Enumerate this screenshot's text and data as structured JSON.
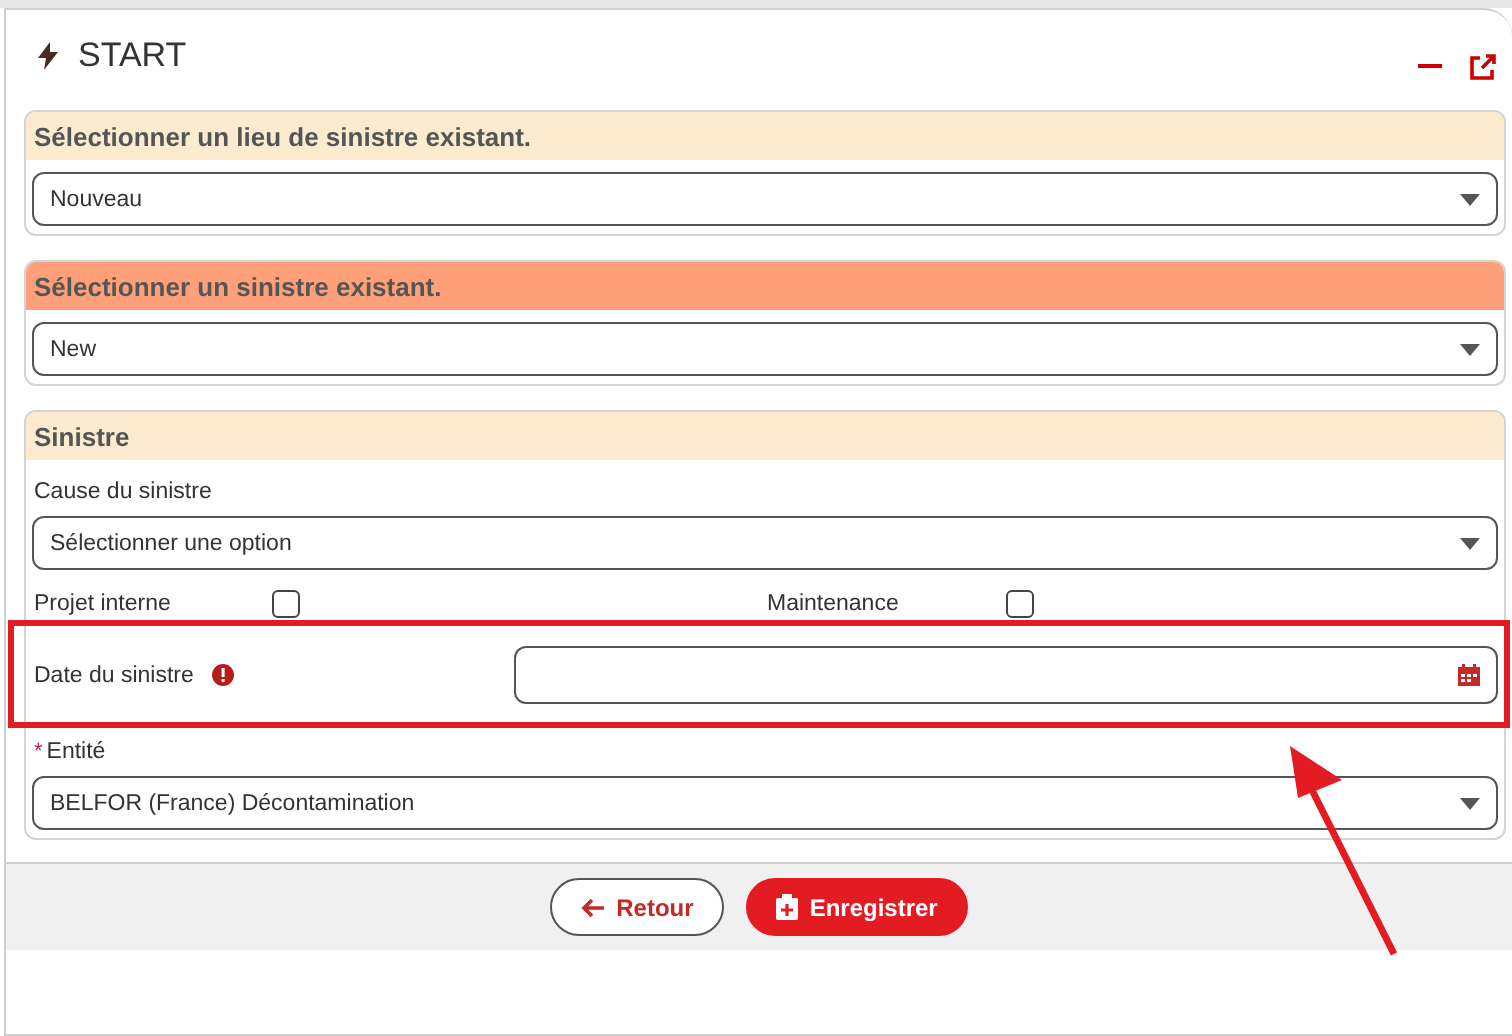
{
  "window": {
    "title": "START"
  },
  "sections": [
    {
      "title": "Sélectionner un lieu de sinistre existant.",
      "emphasized": false,
      "fields": [
        {
          "kind": "select",
          "value": "Nouveau"
        }
      ]
    },
    {
      "title": "Sélectionner un sinistre existant.",
      "emphasized": true,
      "fields": [
        {
          "kind": "select",
          "value": "New"
        }
      ]
    },
    {
      "title": "Sinistre",
      "emphasized": false,
      "fields": [
        {
          "kind": "select",
          "label": "Cause du sinistre",
          "value": "Sélectionner une option",
          "required": false
        },
        {
          "kind": "checks",
          "items": [
            {
              "label": "Projet interne",
              "checked": false
            },
            {
              "label": "Maintenance",
              "checked": false
            }
          ]
        },
        {
          "kind": "date",
          "label": "Date du sinistre",
          "info": true,
          "highlighted": true
        },
        {
          "kind": "select",
          "label": "Entité",
          "value": "BELFOR (France) Décontamination",
          "required": true,
          "required_mark": "*"
        }
      ]
    }
  ],
  "buttons": [
    {
      "kind": "back",
      "label": "Retour"
    },
    {
      "kind": "save",
      "label": "Enregistrer"
    }
  ]
}
